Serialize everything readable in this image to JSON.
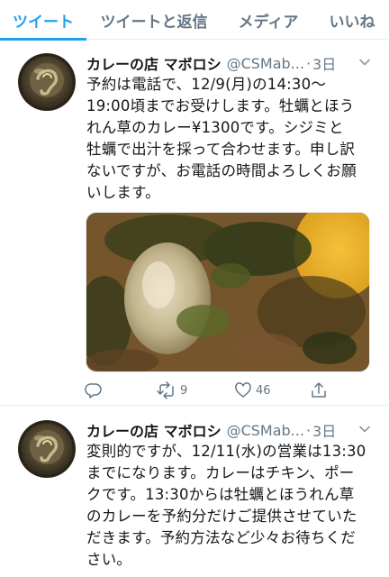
{
  "tabs": [
    {
      "label": "ツイート"
    },
    {
      "label": "ツイートと返信"
    },
    {
      "label": "メディア"
    },
    {
      "label": "いいね"
    }
  ],
  "tweets": [
    {
      "name": "カレーの店 マボロシ",
      "handle": "@CSMab...",
      "time": "3日",
      "lines": [
        "予約は電話で、12/9(月)の14:30〜",
        "19:00頃までお受けします。牡蠣とほう",
        "れん草のカレー¥1300です。シジミと",
        "牡蠣で出汁を採って合わせます。申し訳",
        "ないですが、お電話の時間よろしくお願",
        "いします。"
      ],
      "retweets": "9",
      "likes": "46"
    },
    {
      "name": "カレーの店 マボロシ",
      "handle": "@CSMab...",
      "time": "3日",
      "lines": [
        "変則的ですが、12/11(水)の営業は13:30",
        "までになります。カレーはチキン、ポー",
        "クです。13:30からは牡蠣とほうれん草",
        "のカレーを予約分だけご提供させていた",
        "だきます。予約方法など少々お待ちくだ",
        "さい。"
      ]
    }
  ],
  "colors": {
    "accent": "#1da1f2",
    "secondary_text": "#657786",
    "divider": "#e6ecf0"
  },
  "icons": [
    "reply-icon",
    "retweet-icon",
    "like-icon",
    "share-icon",
    "chevron-down-icon"
  ]
}
